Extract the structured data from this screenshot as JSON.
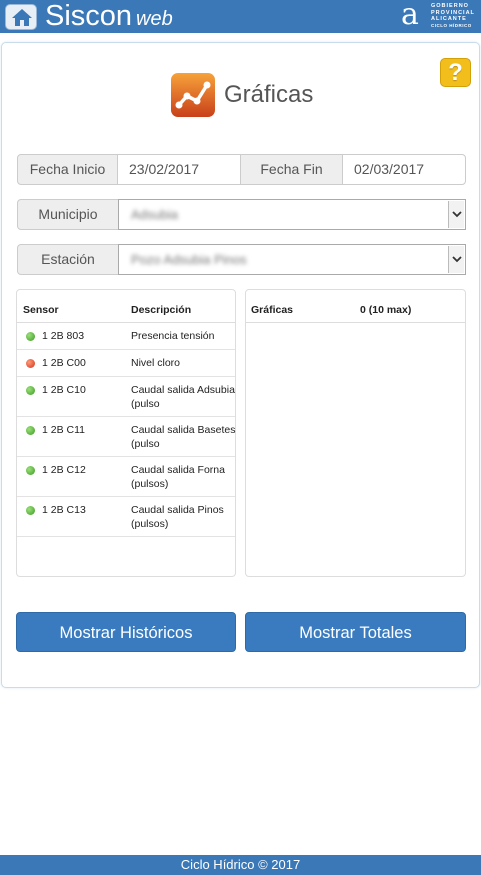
{
  "header": {
    "brand": "Siscon",
    "brand_suffix": "web",
    "logo_lines": [
      "GOBIERNO",
      "PROVINCIAL",
      "ALICANTE",
      "CICLO HÍDRICO"
    ],
    "logo_letter": "a",
    "bar_color": "#3a78b8"
  },
  "page": {
    "title": "Gráficas",
    "help_label": "?"
  },
  "filters": {
    "fecha_inicio_label": "Fecha Inicio",
    "fecha_inicio_value": "23/02/2017",
    "fecha_fin_label": "Fecha Fin",
    "fecha_fin_value": "02/03/2017",
    "municipio_label": "Municipio",
    "municipio_value": "Adsubia",
    "estacion_label": "Estación",
    "estacion_value": "Pozo Adsubia Pinos"
  },
  "sensors_table": {
    "col_sensor": "Sensor",
    "col_descripcion": "Descripción",
    "rows": [
      {
        "code": "1 2B 803",
        "desc": "Presencia tensión",
        "status": "green"
      },
      {
        "code": "1 2B C00",
        "desc": "Nivel cloro",
        "status": "red"
      },
      {
        "code": "1 2B C10",
        "desc": "Caudal salida Adsubia (pulso",
        "status": "green"
      },
      {
        "code": "1 2B C11",
        "desc": "Caudal salida Basetes (pulso",
        "status": "green"
      },
      {
        "code": "1 2B C12",
        "desc": "Caudal salida Forna (pulsos)",
        "status": "green"
      },
      {
        "code": "1 2B C13",
        "desc": "Caudal salida Pinos (pulsos)",
        "status": "green"
      }
    ]
  },
  "graficas_panel": {
    "title": "Gráficas",
    "count": "0 (10 max)"
  },
  "actions": {
    "historicos": "Mostrar Históricos",
    "totales": "Mostrar Totales"
  },
  "footer": {
    "text": "Ciclo Hídrico © 2017"
  }
}
